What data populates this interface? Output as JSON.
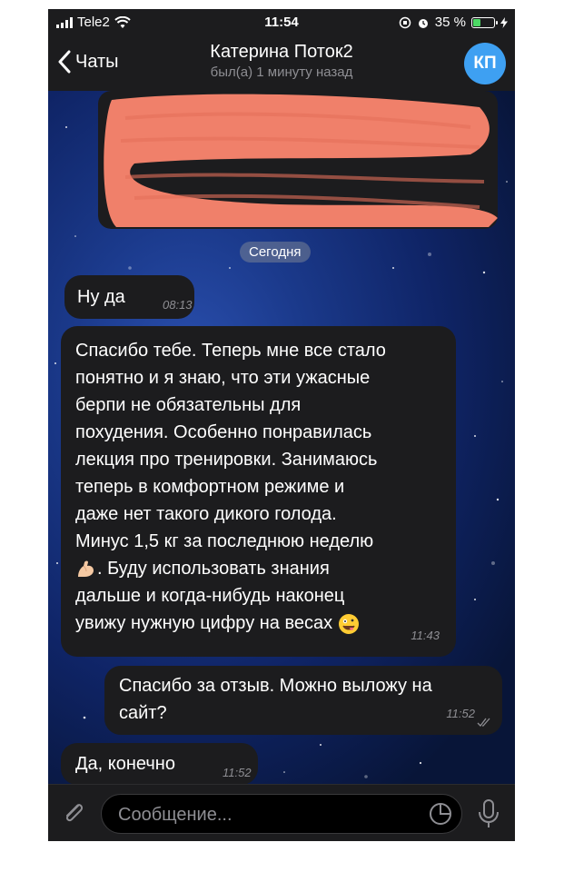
{
  "status_bar": {
    "carrier": "Tele2",
    "time": "11:54",
    "battery": "35 %",
    "battery_level": 0.35
  },
  "header": {
    "back_label": "Чаты",
    "title": "Катерина Поток2",
    "subtitle": "был(а) 1 минуту назад",
    "avatar_initials": "КП",
    "avatar_color": "#3ea0f2"
  },
  "chat": {
    "date_separator": "Сегодня",
    "messages": [
      {
        "direction": "incoming",
        "text": "Ну да",
        "time": "08:13"
      },
      {
        "direction": "incoming",
        "text": "Спасибо тебе. Теперь мне все стало\nпонятно и я знаю, что эти ужасные\nберпи не обязательны для\nпохудения. Особенно понравилась\nлекция про тренировки. Занимаюсь\nтеперь в комфортном  режиме и\nдаже нет такого дикого голода.\nМинус 1,5 кг за последнюю неделю",
        "text_after_emoji": ". Буду использовать знания\nдальше и когда-нибудь наконец\nувижу нужную цифру на весах",
        "emojis": [
          "flexed-biceps-icon",
          "zany-face-icon"
        ],
        "time": "11:43"
      },
      {
        "direction": "outgoing",
        "text": "Спасибо за отзыв. Можно выложу на\nсайт?",
        "time": "11:52",
        "status": "read"
      },
      {
        "direction": "incoming",
        "text": "Да, конечно",
        "time": "11:52"
      }
    ]
  },
  "input": {
    "placeholder": "Сообщение..."
  }
}
